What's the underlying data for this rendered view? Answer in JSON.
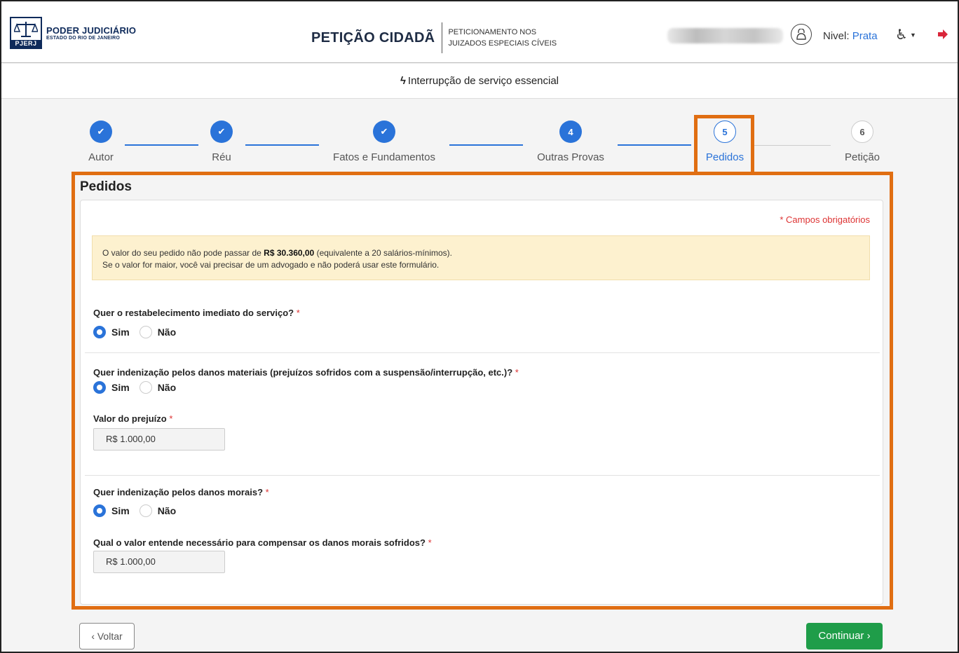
{
  "header": {
    "org_name": "PODER JUDICIÁRIO",
    "org_sub": "ESTADO DO RIO DE JANEIRO",
    "logo_abbr": "PJERJ",
    "app_title": "PETIÇÃO CIDADÃ",
    "app_sub_line1": "PETICIONAMENTO NOS",
    "app_sub_line2": "JUIZADOS ESPECIAIS CÍVEIS",
    "level_label": "Nivel:",
    "level_value": "Prata"
  },
  "subheader": {
    "icon": "bolt-icon",
    "text": "Interrupção de serviço essencial"
  },
  "stepper": {
    "steps": [
      {
        "label": "Autor",
        "state": "done"
      },
      {
        "label": "Réu",
        "state": "done"
      },
      {
        "label": "Fatos e Fundamentos",
        "state": "done"
      },
      {
        "number": "4",
        "label": "Outras Provas",
        "state": "reached"
      },
      {
        "number": "5",
        "label": "Pedidos",
        "state": "active"
      },
      {
        "number": "6",
        "label": "Petição",
        "state": "todo"
      }
    ]
  },
  "form": {
    "title": "Pedidos",
    "required_note": "* Campos obrigatórios",
    "alert": {
      "line1_pre": "O valor do seu pedido não pode passar de ",
      "line1_bold": "R$ 30.360,00",
      "line1_post": " (equivalente a 20 salários-mínimos).",
      "line2": "Se o valor for maior, você vai precisar de um advogado e não poderá usar este formulário."
    },
    "q1": {
      "label": "Quer o restabelecimento imediato do serviço?",
      "ast": "*",
      "yes": "Sim",
      "no": "Não",
      "selected": "Sim"
    },
    "q2": {
      "label": "Quer indenização pelos danos materiais (prejuízos sofridos com a suspensão/interrupção, etc.)?",
      "ast": "*",
      "yes": "Sim",
      "no": "Não",
      "selected": "Sim"
    },
    "q2_value": {
      "label": "Valor do prejuízo",
      "ast": "*",
      "value": "R$ 1.000,00"
    },
    "q3": {
      "label": "Quer indenização pelos danos morais?",
      "ast": "*",
      "yes": "Sim",
      "no": "Não",
      "selected": "Sim"
    },
    "q3_value": {
      "label": "Qual o valor entende necessário para compensar os danos morais sofridos?",
      "ast": "*",
      "value": "R$ 1.000,00"
    }
  },
  "footer": {
    "back": "‹ Voltar",
    "next": "Continuar ›"
  },
  "colors": {
    "accent": "#2a73d9",
    "success": "#1f9d49",
    "highlight": "#e06e12",
    "alert_bg": "#fdf1cf",
    "required": "#d33"
  }
}
